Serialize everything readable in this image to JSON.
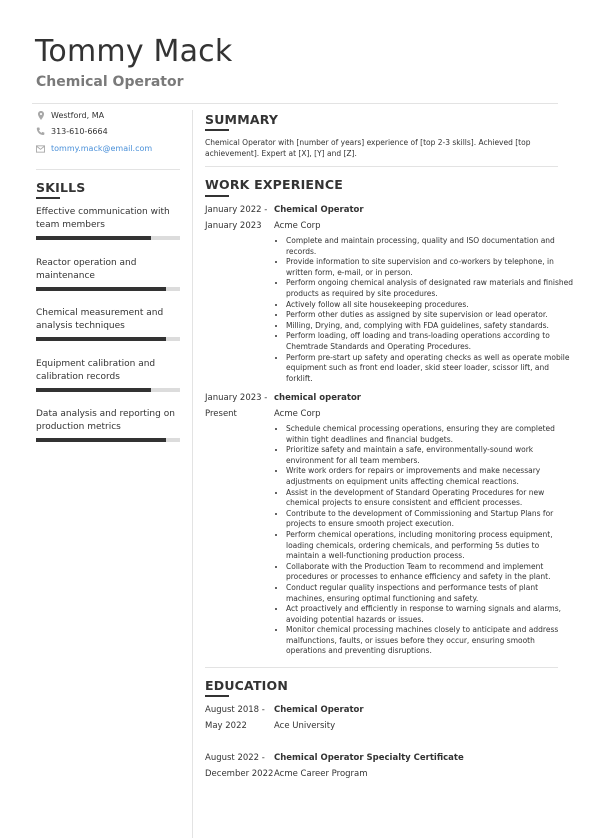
{
  "header": {
    "name": "Tommy Mack",
    "title": "Chemical Operator"
  },
  "contact": {
    "location": "Westford, MA",
    "phone": "313-610-6664",
    "email": "tommy.mack@email.com",
    "icons": [
      "map-pin-icon",
      "phone-icon",
      "envelope-icon"
    ],
    "email_color": "#4a90d9"
  },
  "skills": {
    "heading": "SKILLS",
    "items": [
      {
        "label": "Effective communication with team members",
        "level": 0.8
      },
      {
        "label": "Reactor operation and maintenance",
        "level": 0.9
      },
      {
        "label": "Chemical measurement and analysis techniques",
        "level": 0.9
      },
      {
        "label": "Equipment calibration and calibration records",
        "level": 0.8
      },
      {
        "label": "Data analysis and reporting on production metrics",
        "level": 0.9
      }
    ]
  },
  "summary": {
    "heading": "SUMMARY",
    "text": "Chemical Operator with [number of years] experience of [top 2-3 skills]. Achieved [top achievement]. Expert at [X], [Y] and [Z]."
  },
  "experience": {
    "heading": "WORK EXPERIENCE",
    "jobs": [
      {
        "date_start": "January 2022 -",
        "date_end": "January 2023",
        "role": "Chemical Operator",
        "company": "Acme Corp",
        "bullets": [
          "Complete and maintain processing, quality and ISO documentation and records.",
          "Provide information to site supervision and co-workers by telephone, in written form, e-mail, or in person.",
          "Perform ongoing chemical analysis of designated raw materials and finished products as required by site procedures.",
          "Actively follow all site housekeeping procedures.",
          "Perform other duties as assigned by site supervision or lead operator.",
          "Milling, Drying, and, complying with FDA guidelines, safety standards.",
          "Perform loading, off loading and trans-loading operations according to Chemtrade Standards and Operating Procedures.",
          "Perform pre-start up safety and operating checks as well as operate mobile equipment such as front end loader, skid steer loader, scissor lift, and forklift."
        ]
      },
      {
        "date_start": "January 2023 -",
        "date_end": "Present",
        "role": "chemical operator",
        "company": "Acme Corp",
        "bullets": [
          "Schedule chemical processing operations, ensuring they are completed within tight deadlines and financial budgets.",
          "Prioritize safety and maintain a safe, environmentally-sound work environment for all team members.",
          "Write work orders for repairs or improvements and make necessary adjustments on equipment units affecting chemical reactions.",
          "Assist in the development of Standard Operating Procedures for new chemical projects to ensure consistent and efficient processes.",
          "Contribute to the development of Commissioning and Startup Plans for projects to ensure smooth project execution.",
          "Perform chemical operations, including monitoring process equipment, loading chemicals, ordering chemicals, and performing 5s duties to maintain a well-functioning production process.",
          "Collaborate with the Production Team to recommend and implement procedures or processes to enhance efficiency and safety in the plant.",
          "Conduct regular quality inspections and performance tests of plant machines, ensuring optimal functioning and safety.",
          "Act proactively and efficiently in response to warning signals and alarms, avoiding potential hazards or issues.",
          "Monitor chemical processing machines closely to anticipate and address malfunctions, faults, or issues before they occur, ensuring smooth operations and preventing disruptions."
        ]
      }
    ]
  },
  "education": {
    "heading": "EDUCATION",
    "items": [
      {
        "date_start": "August 2018 -",
        "date_end": "May 2022",
        "degree": "Chemical Operator",
        "school": "Ace University"
      },
      {
        "date_start": "August 2022 -",
        "date_end": "December 2022",
        "degree": "Chemical Operator Specialty Certificate",
        "school": "Acme Career Program"
      }
    ]
  }
}
